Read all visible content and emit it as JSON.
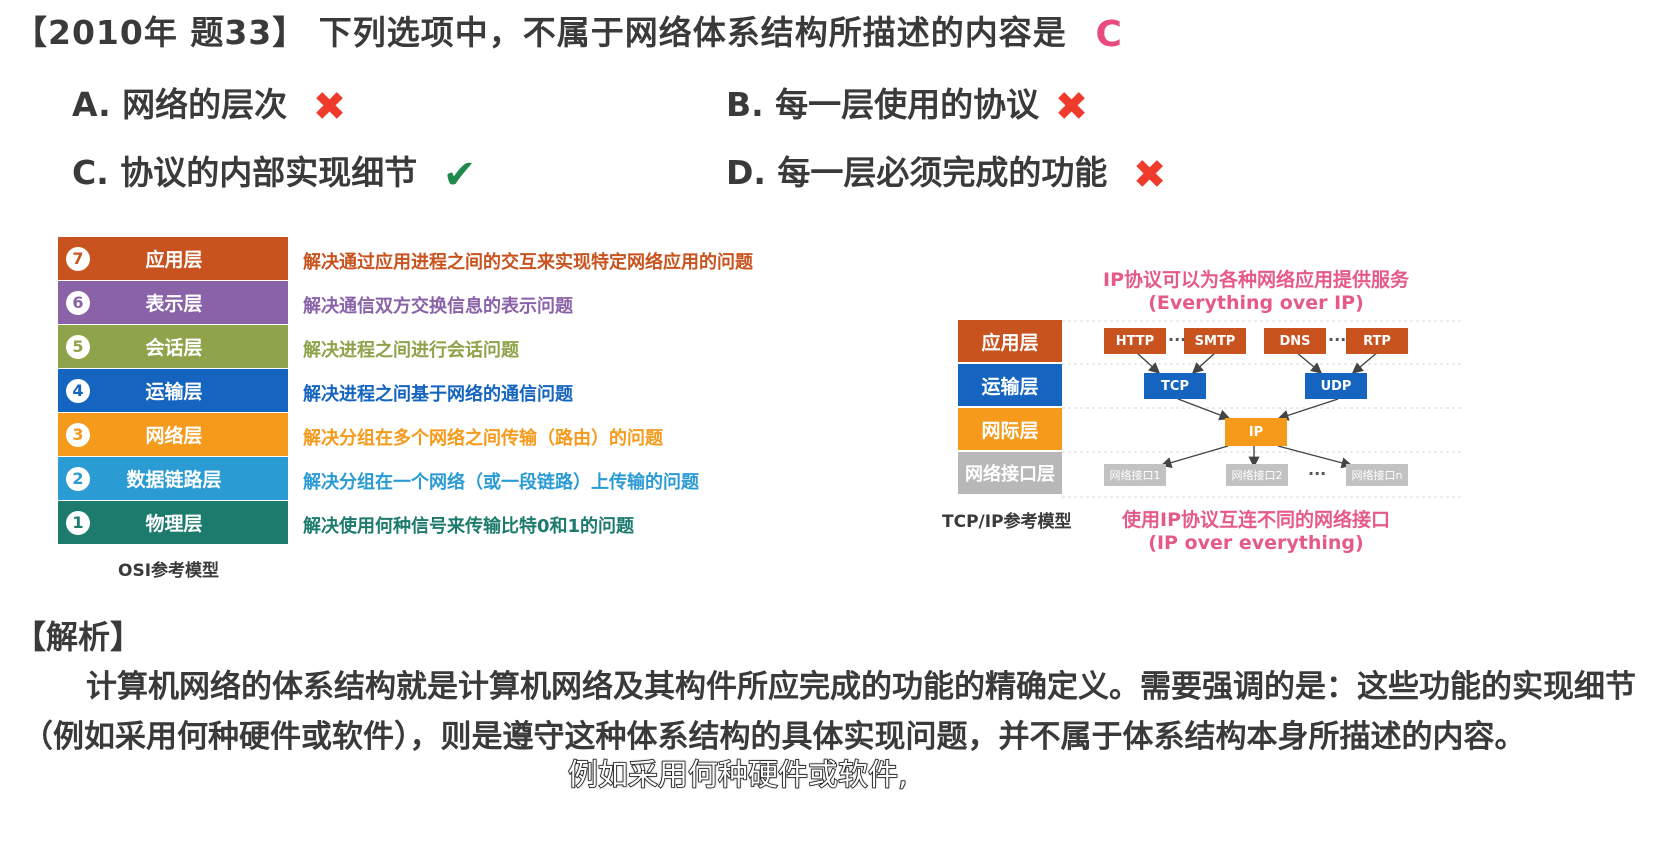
{
  "question": {
    "title": "【2010年 题33】 下列选项中，不属于网络体系结构所描述的内容是",
    "answer": "C"
  },
  "options": [
    {
      "label": "A. 网络的层次",
      "mark": "✖",
      "correct": false
    },
    {
      "label": "B. 每一层使用的协议",
      "mark": "✖",
      "correct": false
    },
    {
      "label": "C. 协议的内部实现细节",
      "mark": "✔",
      "correct": true
    },
    {
      "label": "D. 每一层必须完成的功能",
      "mark": "✖",
      "correct": false
    }
  ],
  "osi": {
    "caption": "OSI参考模型",
    "layers": [
      {
        "num": "7",
        "name": "应用层",
        "desc": "解决通过应用进程之间的交互来实现特定网络应用的问题",
        "color": "#c8531e"
      },
      {
        "num": "6",
        "name": "表示层",
        "desc": "解决通信双方交换信息的表示问题",
        "color": "#8a62a8"
      },
      {
        "num": "5",
        "name": "会话层",
        "desc": "解决进程之间进行会话问题",
        "color": "#8ea34a"
      },
      {
        "num": "4",
        "name": "运输层",
        "desc": "解决进程之间基于网络的通信问题",
        "color": "#1565c0"
      },
      {
        "num": "3",
        "name": "网络层",
        "desc": "解决分组在多个网络之间传输（路由）的问题",
        "color": "#f59a1b"
      },
      {
        "num": "2",
        "name": "数据链路层",
        "desc": "解决分组在一个网络（或一段链路）上传输的问题",
        "color": "#2b9bd4"
      },
      {
        "num": "1",
        "name": "物理层",
        "desc": "解决使用何种信号来传输比特0和1的问题",
        "color": "#1d7b6e"
      }
    ]
  },
  "tcpip": {
    "caption": "TCP/IP参考模型",
    "top_note_1": "IP协议可以为各种网络应用提供服务",
    "top_note_2": "(Everything over IP)",
    "bottom_note_1": "使用IP协议互连不同的网络接口",
    "bottom_note_2": "(IP over everything)",
    "layers": [
      {
        "name": "应用层",
        "color": "#c8531e"
      },
      {
        "name": "运输层",
        "color": "#1565c0"
      },
      {
        "name": "网际层",
        "color": "#f59a1b"
      },
      {
        "name": "网络接口层",
        "color": "#b8b8b8"
      }
    ],
    "app_protocols": [
      "HTTP",
      "SMTP",
      "DNS",
      "RTP"
    ],
    "transport_protocols": [
      "TCP",
      "UDP"
    ],
    "network_protocol": "IP",
    "interfaces": [
      "网络接口1",
      "网络接口2",
      "网络接口n"
    ],
    "ellipsis": "···"
  },
  "analysis": {
    "heading": "【解析】",
    "body": "计算机网络的体系结构就是计算机网络及其构件所应完成的功能的精确定义。需要强调的是：这些功能的实现细节（例如采用何种硬件或软件），则是遵守这种体系结构的具体实现问题，并不属于体系结构本身所描述的内容。"
  },
  "subtitle": "例如采用何种硬件或软件,"
}
